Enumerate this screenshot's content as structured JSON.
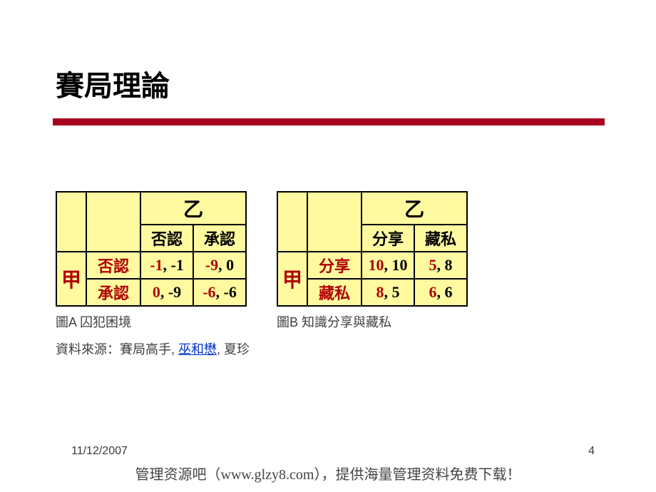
{
  "title": "賽局理論",
  "tableA": {
    "playerCol": "乙",
    "playerRow": "甲",
    "colStrategies": [
      "否認",
      "承認"
    ],
    "rowStrategies": [
      "否認",
      "承認"
    ],
    "cells": [
      [
        {
          "r": "-1",
          "b": "-1"
        },
        {
          "r": "-9",
          "b": "0"
        }
      ],
      [
        {
          "r": "0",
          "b": "-9"
        },
        {
          "r": "-6",
          "b": "-6"
        }
      ]
    ],
    "caption": "圖A 囚犯困境"
  },
  "tableB": {
    "playerCol": "乙",
    "playerRow": "甲",
    "colStrategies": [
      "分享",
      "藏私"
    ],
    "rowStrategies": [
      "分享",
      "藏私"
    ],
    "cells": [
      [
        {
          "r": "10",
          "b": "10"
        },
        {
          "r": "5",
          "b": "8"
        }
      ],
      [
        {
          "r": "8",
          "b": "5"
        },
        {
          "r": "6",
          "b": "6"
        }
      ]
    ],
    "caption": "圖B 知識分享與藏私"
  },
  "source": {
    "prefix": "資料來源：賽局高手, ",
    "link": "巫和懋",
    "suffix": ", 夏珍"
  },
  "footer": {
    "date": "11/12/2007",
    "page": "4",
    "note": "管理资源吧（www.glzy8.com），提供海量管理资料免费下载！"
  }
}
